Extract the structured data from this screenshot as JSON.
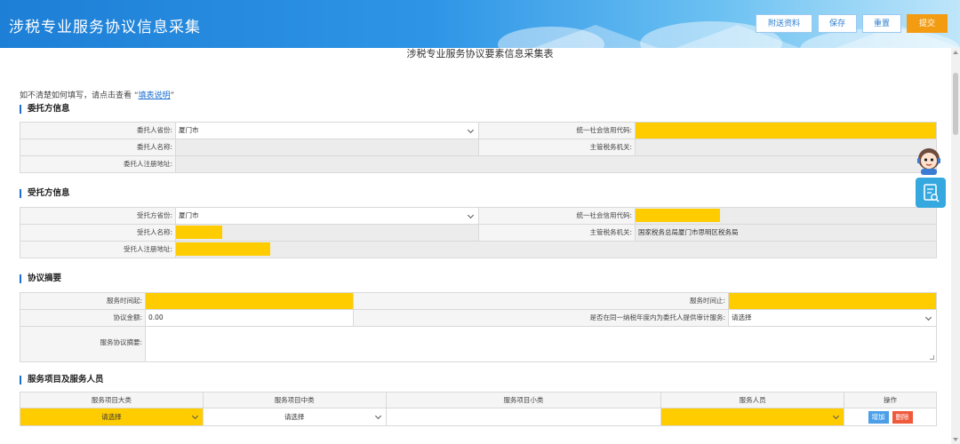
{
  "app": {
    "title": "涉税专业服务协议信息采集"
  },
  "toolbar": {
    "attach": "附送资料",
    "save": "保存",
    "reset": "重置",
    "submit": "提交"
  },
  "form": {
    "title": "涉税专业服务协议要素信息采集表",
    "hint_prefix": "如不清楚如何填写，请点击查看 “",
    "hint_link": "填表说明",
    "hint_suffix": "”"
  },
  "client": {
    "section_title": "委托方信息",
    "province_label": "委托人省份:",
    "province_value": "厦门市",
    "credit_code_label": "统一社会信用代码:",
    "name_label": "委托人名称:",
    "tax_authority_label": "主管税务机关:",
    "address_label": "委托人注册地址:"
  },
  "agent": {
    "section_title": "受托方信息",
    "province_label": "受托方省份:",
    "province_value": "厦门市",
    "credit_code_label": "统一社会信用代码:",
    "name_label": "受托人名称:",
    "tax_authority_label": "主管税务机关:",
    "tax_authority_value": "国家税务总局厦门市思明区税务局",
    "address_label": "受托人注册地址:"
  },
  "agreement": {
    "section_title": "协议摘要",
    "start_label": "服务时间起:",
    "end_label": "服务时间止:",
    "amount_label": "协议金额:",
    "amount_value": "0.00",
    "audit_label": "是否在同一纳税年度内为委托人提供审计服务:",
    "audit_value": "请选择",
    "summary_label": "服务协议摘要:"
  },
  "services": {
    "section_title": "服务项目及服务人员",
    "columns": [
      "服务项目大类",
      "服务项目中类",
      "服务项目小类",
      "服务人员",
      "操作"
    ],
    "row": {
      "major": "请选择",
      "middle": "请选择",
      "add": "增加",
      "delete": "删除"
    }
  }
}
